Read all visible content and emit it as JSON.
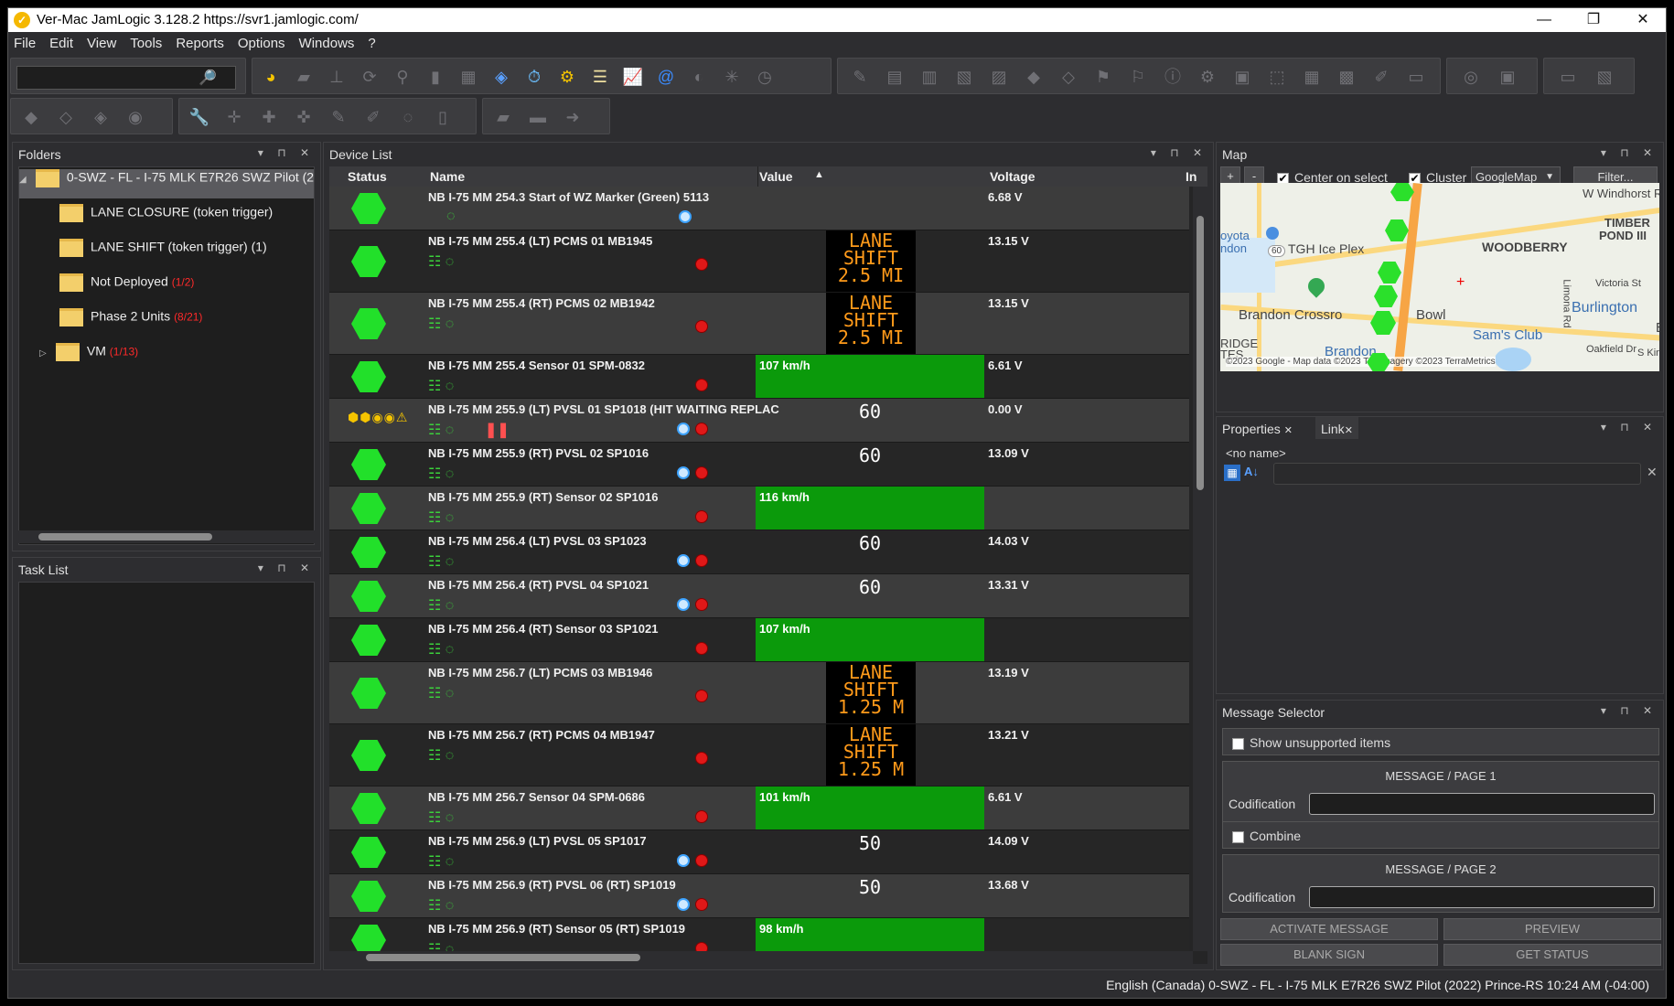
{
  "window": {
    "title": "Ver-Mac JamLogic 3.128.2 https://svr1.jamlogic.com/",
    "minimize": "—",
    "restore": "❐",
    "close": "✕"
  },
  "menu": [
    "File",
    "Edit",
    "View",
    "Tools",
    "Reports",
    "Options",
    "Windows",
    "?"
  ],
  "folders": {
    "title": "Folders",
    "items": [
      {
        "label": "0-SWZ - FL - I-75 MLK E7R26 SWZ Pilot (20",
        "count": ""
      },
      {
        "label": "LANE CLOSURE (token trigger)",
        "count": ""
      },
      {
        "label": "LANE SHIFT (token trigger) (1)",
        "count": ""
      },
      {
        "label": "Not Deployed",
        "count": "(1/2)"
      },
      {
        "label": "Phase 2 Units",
        "count": "(8/21)"
      },
      {
        "label": "VM",
        "count": "(1/13)"
      }
    ]
  },
  "tasklist": {
    "title": "Task List"
  },
  "devicelist": {
    "title": "Device List",
    "columns": {
      "status": "Status",
      "name": "Name",
      "value": "Value",
      "voltage": "Voltage",
      "extra": "In"
    },
    "rows": [
      {
        "name": "NB I-75 MM 254.3 Start of WZ Marker (Green) 5113",
        "kind": "marker",
        "value": "",
        "voltage": "6.68 V"
      },
      {
        "name": "NB I-75 MM 255.4 (LT) PCMS 01 MB1945",
        "kind": "pcms",
        "value": "LANE|SHIFT|2.5 MI",
        "voltage": "13.15 V"
      },
      {
        "name": "NB I-75 MM 255.4 (RT) PCMS 02 MB1942",
        "kind": "pcms",
        "value": "LANE|SHIFT|2.5 MI",
        "voltage": "13.15 V"
      },
      {
        "name": "NB I-75 MM 255.4 Sensor 01 SPM-0832",
        "kind": "sensor",
        "value": "107 km/h",
        "voltage": "6.61 V"
      },
      {
        "name": "NB I-75 MM 255.9 (LT) PVSL 01 SP1018 (HIT WAITING REPLAC",
        "kind": "pvsl-warn",
        "value": "60",
        "voltage": "0.00 V"
      },
      {
        "name": "NB I-75 MM 255.9 (RT) PVSL 02 SP1016",
        "kind": "pvsl",
        "value": "60",
        "voltage": "13.09 V"
      },
      {
        "name": "NB I-75 MM 255.9 (RT) Sensor 02 SP1016",
        "kind": "sensor",
        "value": "116 km/h",
        "voltage": ""
      },
      {
        "name": "NB I-75 MM 256.4 (LT) PVSL 03 SP1023",
        "kind": "pvsl",
        "value": "60",
        "voltage": "14.03 V"
      },
      {
        "name": "NB I-75 MM 256.4 (RT) PVSL 04 SP1021",
        "kind": "pvsl",
        "value": "60",
        "voltage": "13.31 V"
      },
      {
        "name": "NB I-75 MM 256.4 (RT) Sensor 03 SP1021",
        "kind": "sensor",
        "value": "107 km/h",
        "voltage": ""
      },
      {
        "name": "NB I-75 MM 256.7 (LT) PCMS 03 MB1946",
        "kind": "pcms",
        "value": "LANE|SHIFT|1.25 M",
        "voltage": "13.19 V"
      },
      {
        "name": "NB I-75 MM 256.7 (RT) PCMS 04 MB1947",
        "kind": "pcms",
        "value": "LANE|SHIFT|1.25 M",
        "voltage": "13.21 V"
      },
      {
        "name": "NB I-75 MM 256.7 Sensor 04 SPM-0686",
        "kind": "sensor",
        "value": "101 km/h",
        "voltage": "6.61 V"
      },
      {
        "name": "NB I-75 MM 256.9 (LT) PVSL 05 SP1017",
        "kind": "pvsl",
        "value": "50",
        "voltage": "14.09 V"
      },
      {
        "name": "NB I-75 MM 256.9 (RT) PVSL 06 (RT) SP1019",
        "kind": "pvsl",
        "value": "50",
        "voltage": "13.68 V"
      },
      {
        "name": "NB I-75 MM 256.9 (RT) Sensor 05 (RT) SP1019",
        "kind": "sensor",
        "value": "98 km/h",
        "voltage": ""
      }
    ]
  },
  "map": {
    "title": "Map",
    "zoom_in": "+",
    "zoom_out": "-",
    "center_on_select": "Center on select",
    "cluster": "Cluster",
    "provider": "GoogleMap",
    "filter": "Filter...",
    "labels": {
      "windhorst": "W Windhorst Rd",
      "timber": "TIMBER",
      "pond": "POND III",
      "toyota": "oyota",
      "toyota2": "ndon",
      "tgh": "TGH Ice Plex",
      "woodberry": "WOODBERRY",
      "victoria": "Victoria St",
      "limona": "Limona Rd",
      "burlington": "Burlington",
      "brandon_cross": "Brandon Crossro",
      "bowl": "Bowl",
      "sams": "Sam's Club",
      "ridge": "RIDGE",
      "tes": "TES",
      "brandon": "Brandon",
      "oakfield": "Oakfield Dr",
      "kings": "S Kings",
      "b": "B",
      "hwy": "60",
      "attribution": "©2023 Google - Map data ©2023 Tele     magery ©2023 TerraMetrics"
    }
  },
  "properties": {
    "tab1": "Properties",
    "tab2": "Link",
    "noname": "<no name>",
    "close": "✕"
  },
  "message_selector": {
    "title": "Message Selector",
    "show_unsupported": "Show unsupported items",
    "page1": "MESSAGE / PAGE 1",
    "codification1": "Codification",
    "combine": "Combine",
    "page2": "MESSAGE / PAGE 2",
    "codification2": "Codification",
    "activate": "ACTIVATE MESSAGE",
    "preview": "PREVIEW",
    "blank": "BLANK SIGN",
    "getstatus": "GET STATUS"
  },
  "status": {
    "text": "English (Canada) 0-SWZ - FL - I-75 MLK E7R26 SWZ Pilot (2022) Prince-RS 10:24 AM (-04:00)"
  },
  "colors": {
    "accent_green": "#22e02a",
    "speed_bar": "#0b9a0b",
    "pcms_text": "#ff9a1a",
    "count_red": "#ff2a2a"
  }
}
